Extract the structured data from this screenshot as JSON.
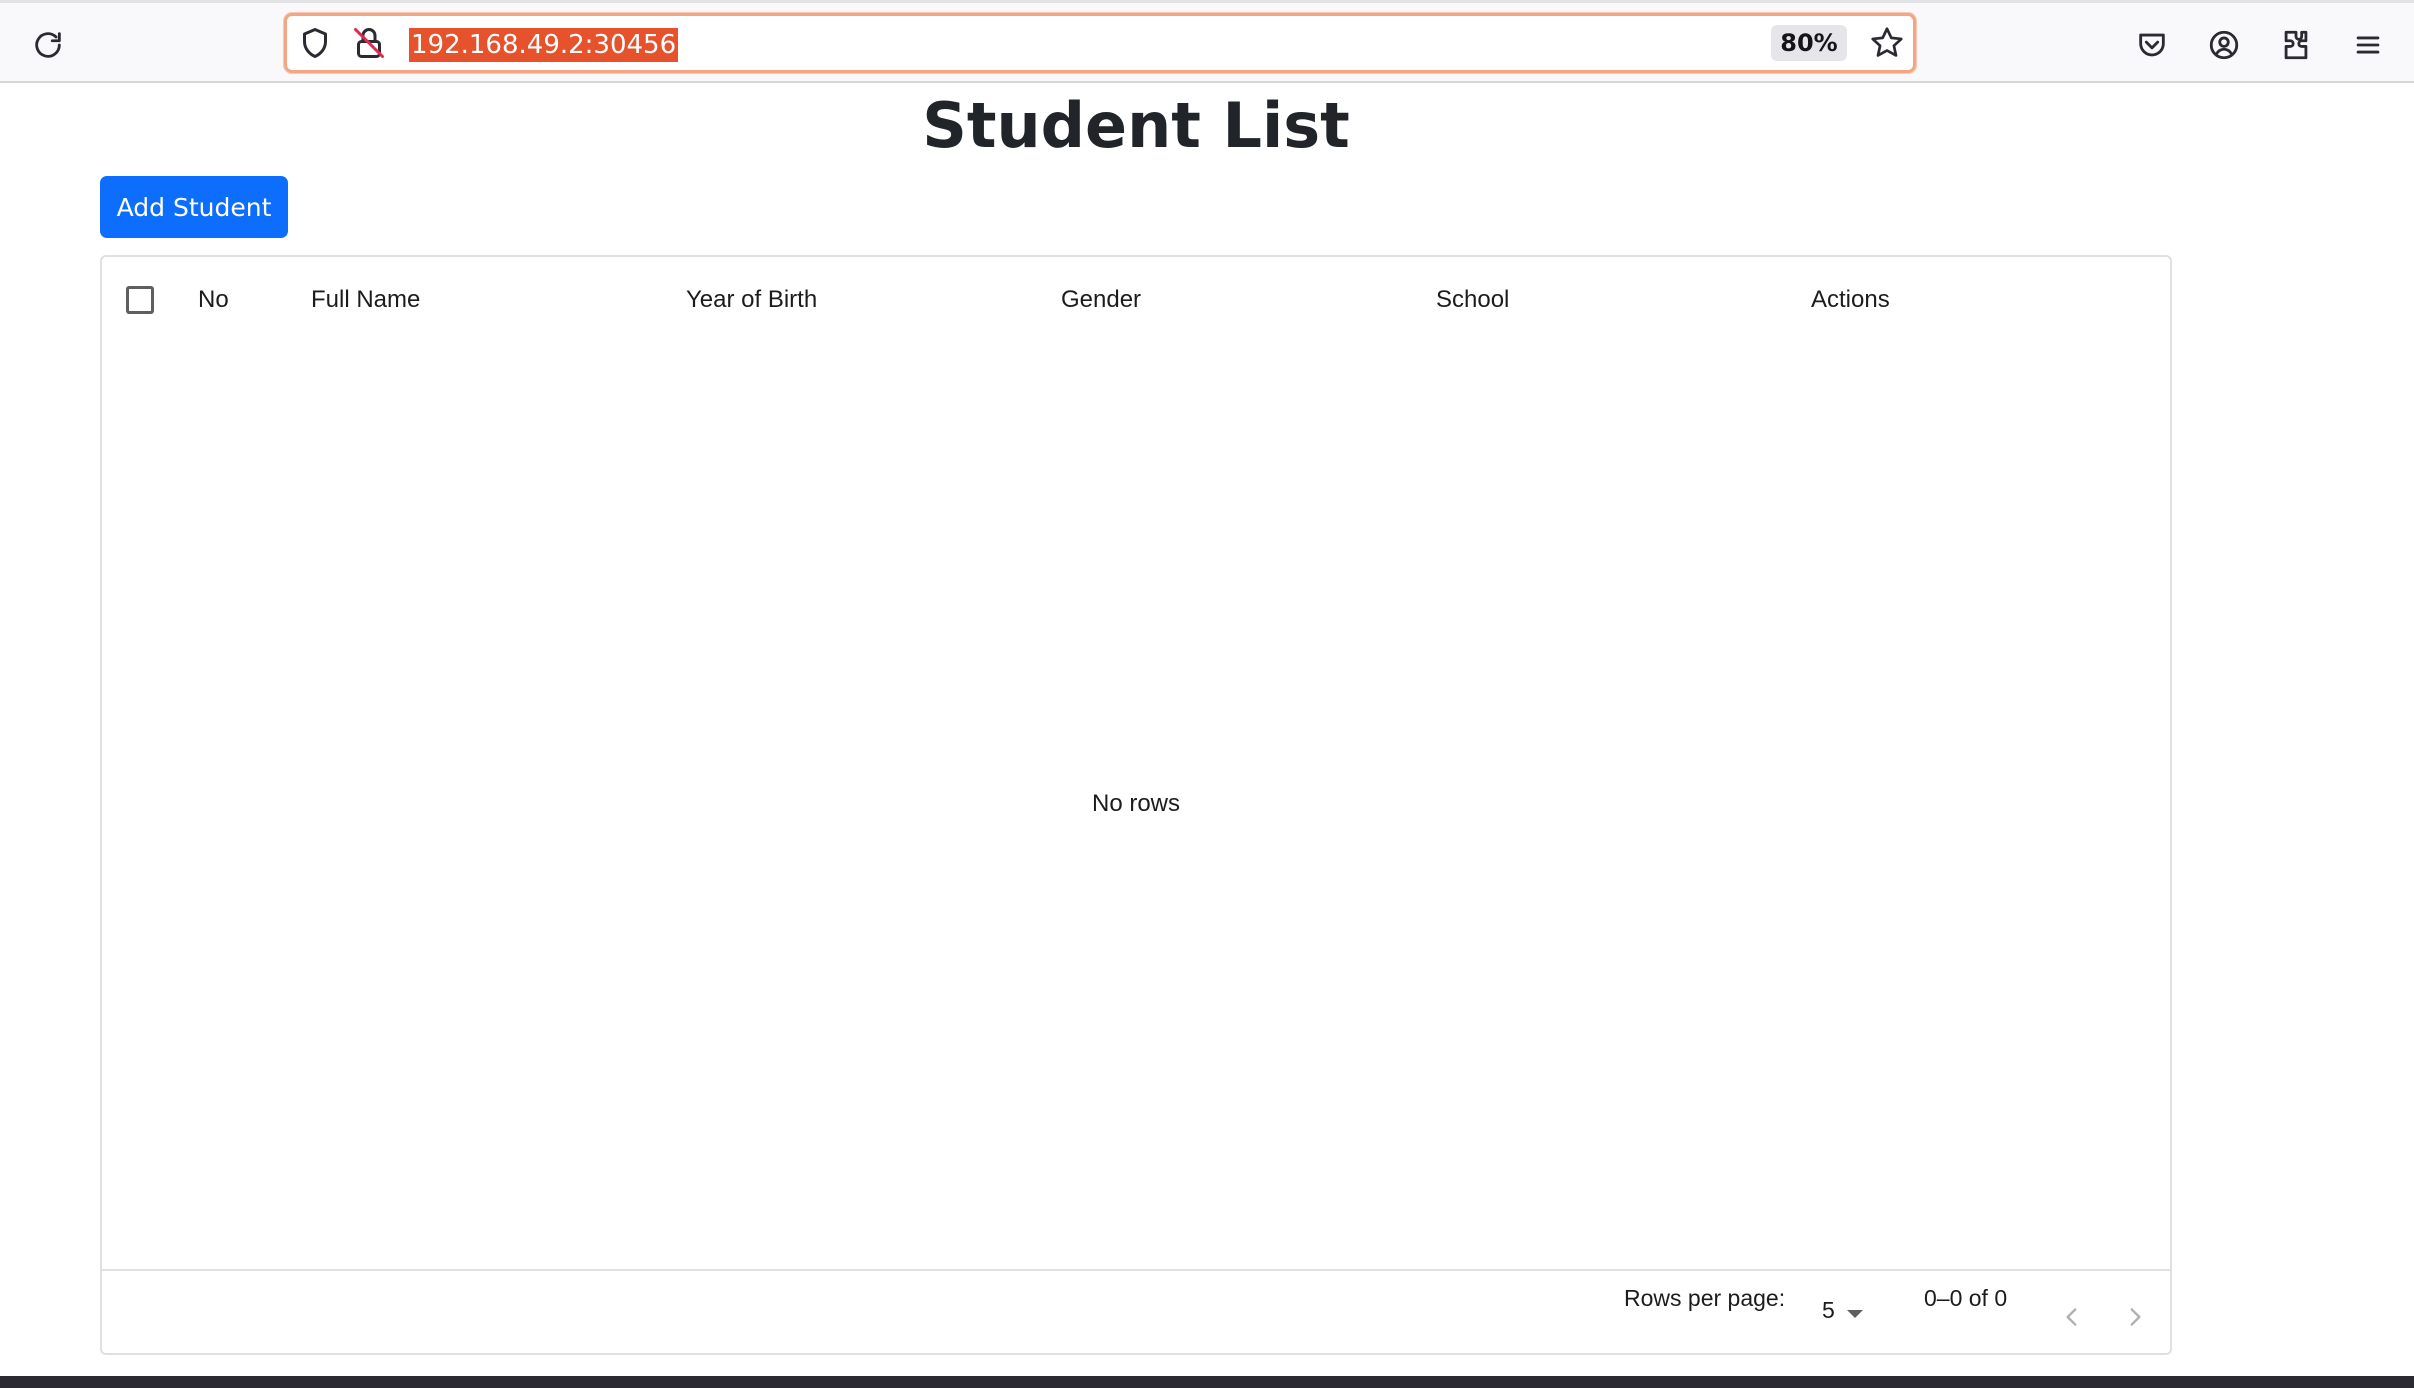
{
  "browser": {
    "url": "192.168.49.2:30456",
    "zoom": "80%"
  },
  "page": {
    "title": "Student List",
    "add_button_label": "Add Student"
  },
  "table": {
    "columns": [
      "No",
      "Full Name",
      "Year of Birth",
      "Gender",
      "School",
      "Actions"
    ],
    "rows": [],
    "empty_message": "No rows",
    "footer": {
      "rows_per_page_label": "Rows per page:",
      "rows_per_page_value": "5",
      "range_text": "0–0 of 0"
    }
  },
  "colors": {
    "primary": "#0d6efd",
    "url_highlight": "#e5522b"
  }
}
